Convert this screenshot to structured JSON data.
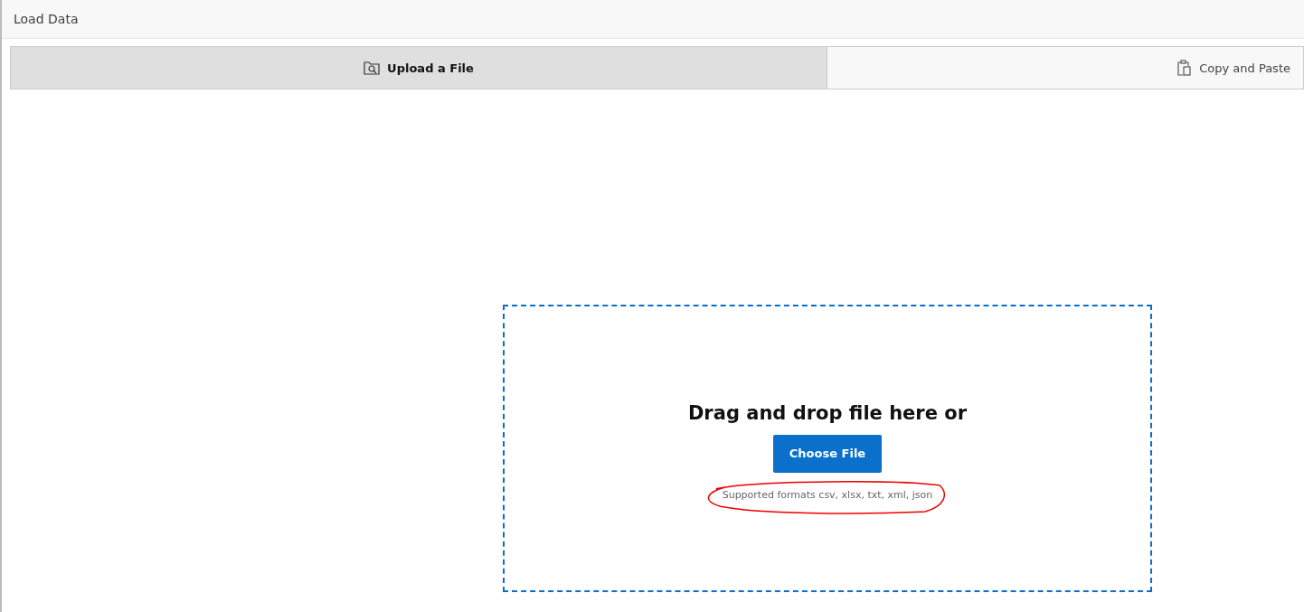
{
  "header": {
    "title": "Load Data"
  },
  "tabs": [
    {
      "label": "Upload a File",
      "kind": "upload",
      "selected": true
    },
    {
      "label": "Copy and Paste",
      "kind": "paste",
      "selected": false
    }
  ],
  "dropzone": {
    "heading": "Drag and drop file here or",
    "button": "Choose File",
    "hint": "Supported formats csv, xlsx, txt, xml, json",
    "hint_circled": true
  }
}
